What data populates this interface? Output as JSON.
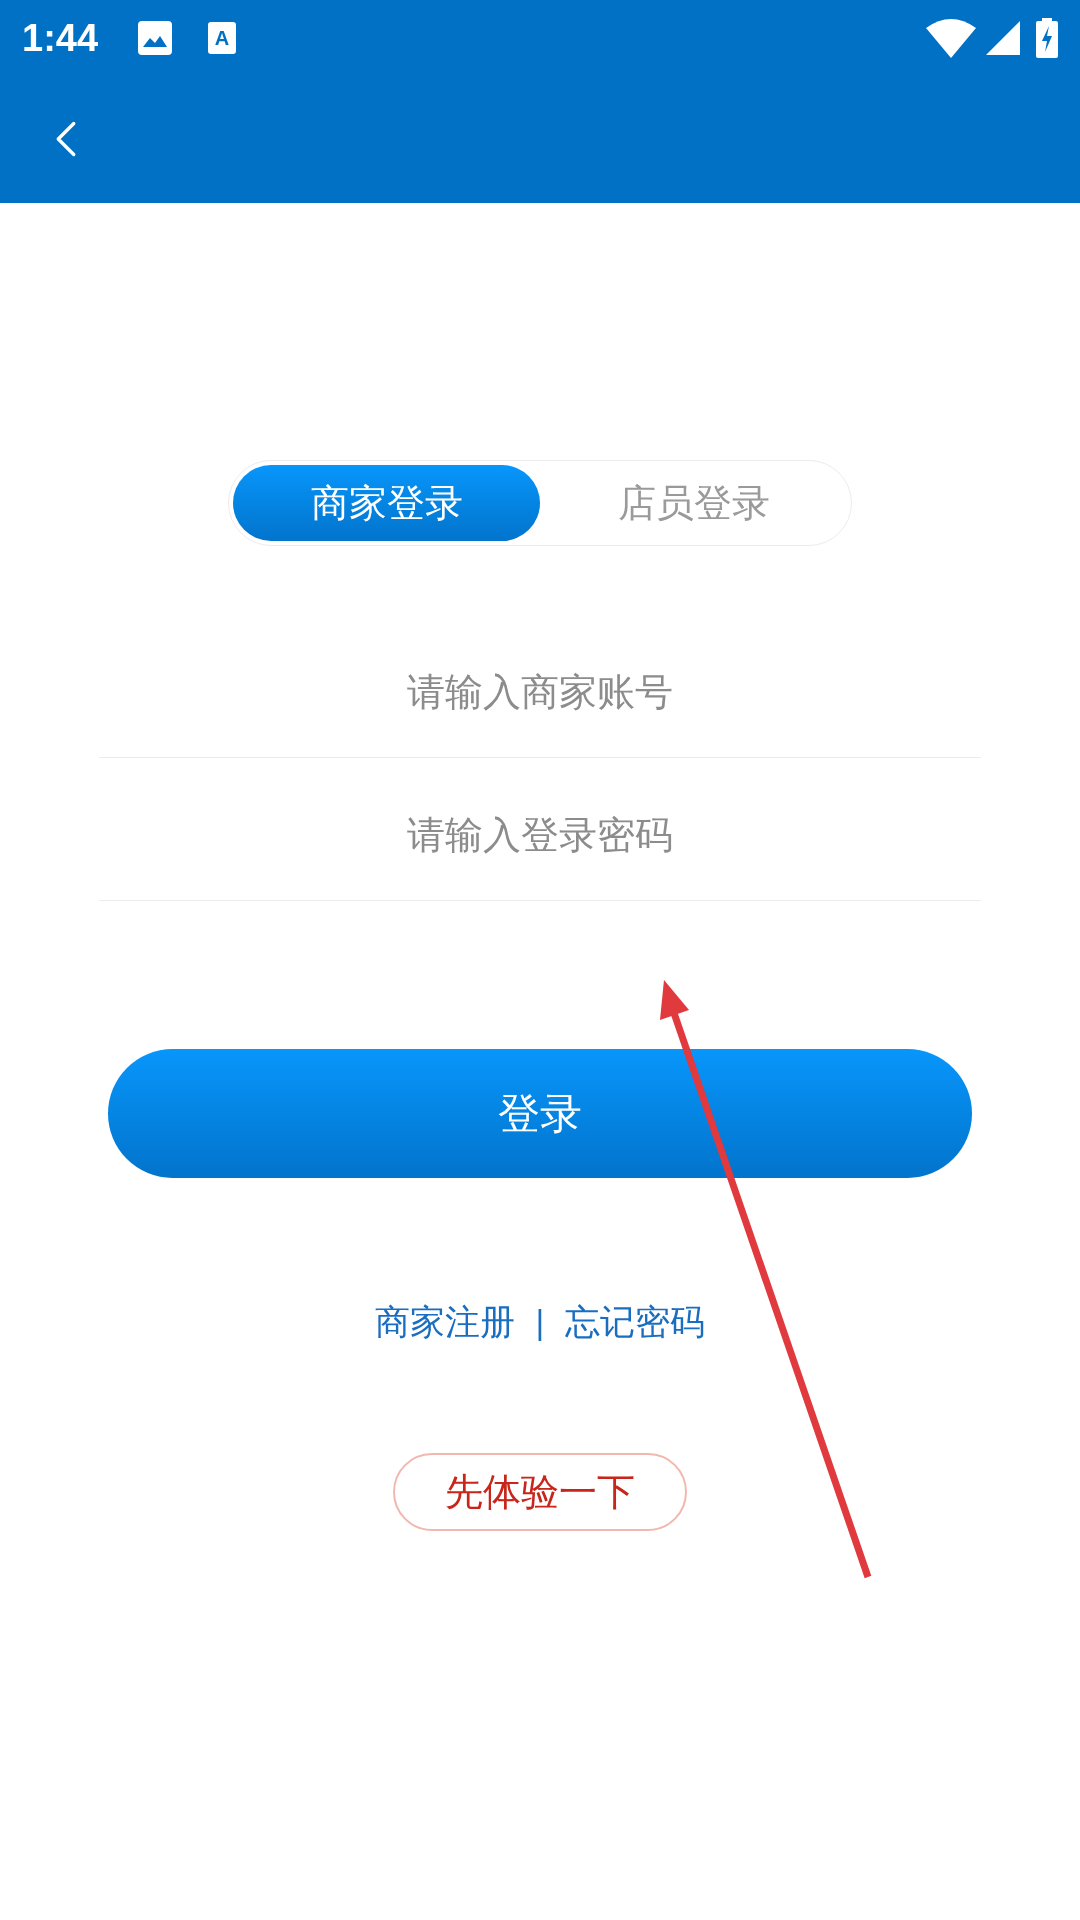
{
  "status_bar": {
    "time": "1:44",
    "notification_letter": "A"
  },
  "tabs": [
    {
      "label": "商家登录",
      "selected": true
    },
    {
      "label": "店员登录",
      "selected": false
    }
  ],
  "fields": [
    {
      "placeholder": "请输入商家账号"
    },
    {
      "placeholder": "请输入登录密码"
    }
  ],
  "login_button": {
    "label": "登录"
  },
  "links": [
    "商家注册",
    "忘记密码"
  ],
  "links_separator": "|",
  "trial_button": {
    "label": "先体验一下"
  }
}
